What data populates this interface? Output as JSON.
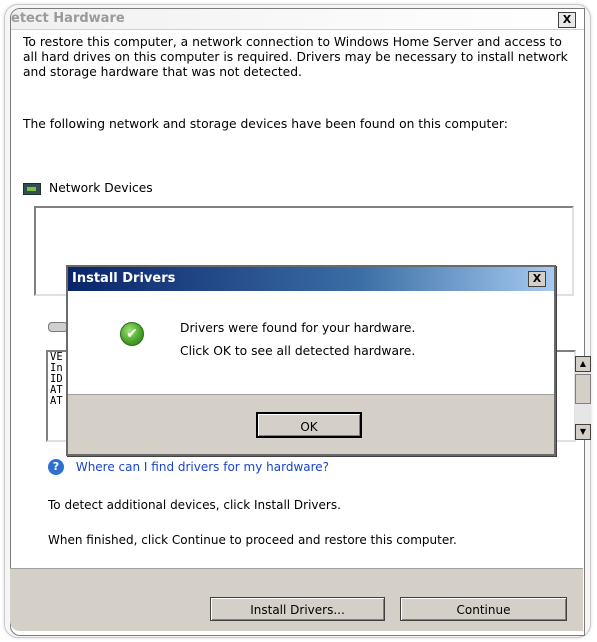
{
  "main_window": {
    "title": "etect Hardware",
    "close_label": "X",
    "intro_text": "To restore this computer, a network connection to Windows Home Server and access to all hard drives on this computer is required. Drivers may be necessary to install network and storage hardware that was not detected.",
    "found_text": "The following network and storage devices have been found on this computer:",
    "network_devices_label": "Network Devices",
    "storage_rows": [
      "VE",
      "In",
      "ID",
      "AT",
      "AT"
    ],
    "scroll_up": "▲",
    "scroll_down": "▼",
    "help_link": "Where can I find drivers for my hardware?",
    "help_icon": "?",
    "detect_text": "To detect additional devices, click Install Drivers.",
    "finish_text": "When finished, click Continue to proceed and restore this computer.",
    "install_button": "Install Drivers...",
    "continue_button": "Continue"
  },
  "dialog": {
    "title": "Install Drivers",
    "close_label": "X",
    "check_glyph": "✔",
    "message_line1": "Drivers were found for your hardware.",
    "message_line2": "Click OK to see all detected hardware.",
    "ok_button": "OK"
  },
  "icons": {
    "network": "network-card-icon",
    "storage": "hard-drive-icon",
    "help": "help-icon",
    "check": "checkmark-icon"
  },
  "colors": {
    "dialog_title_start": "#0a246a",
    "dialog_title_end": "#a6caf0",
    "link": "#1a44c8",
    "button_face": "#d4d0c8"
  }
}
